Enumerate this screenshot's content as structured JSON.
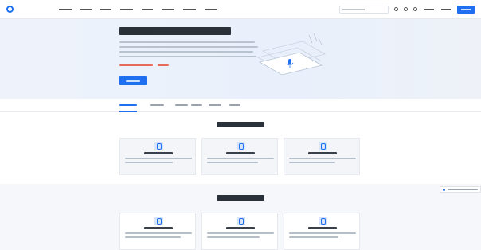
{
  "colors": {
    "brand_blue": "#1f6ff0",
    "hero_background": "#eef3fb",
    "highlight_red": "#e86a5b"
  },
  "icons": [
    "logo-ring-icon",
    "search-icon",
    "microphone-icon",
    "speaker-icon"
  ],
  "hero": {
    "illustration": "microphone-icon"
  },
  "sections": {
    "recognition": {
      "cards": [
        {
          "icon": "microphone-icon"
        },
        {
          "icon": "microphone-icon"
        },
        {
          "icon": "microphone-icon"
        }
      ]
    },
    "synthesis": {
      "cards": [
        {
          "icon": "speaker-icon"
        },
        {
          "icon": "speaker-icon"
        },
        {
          "icon": "speaker-icon"
        }
      ]
    }
  }
}
